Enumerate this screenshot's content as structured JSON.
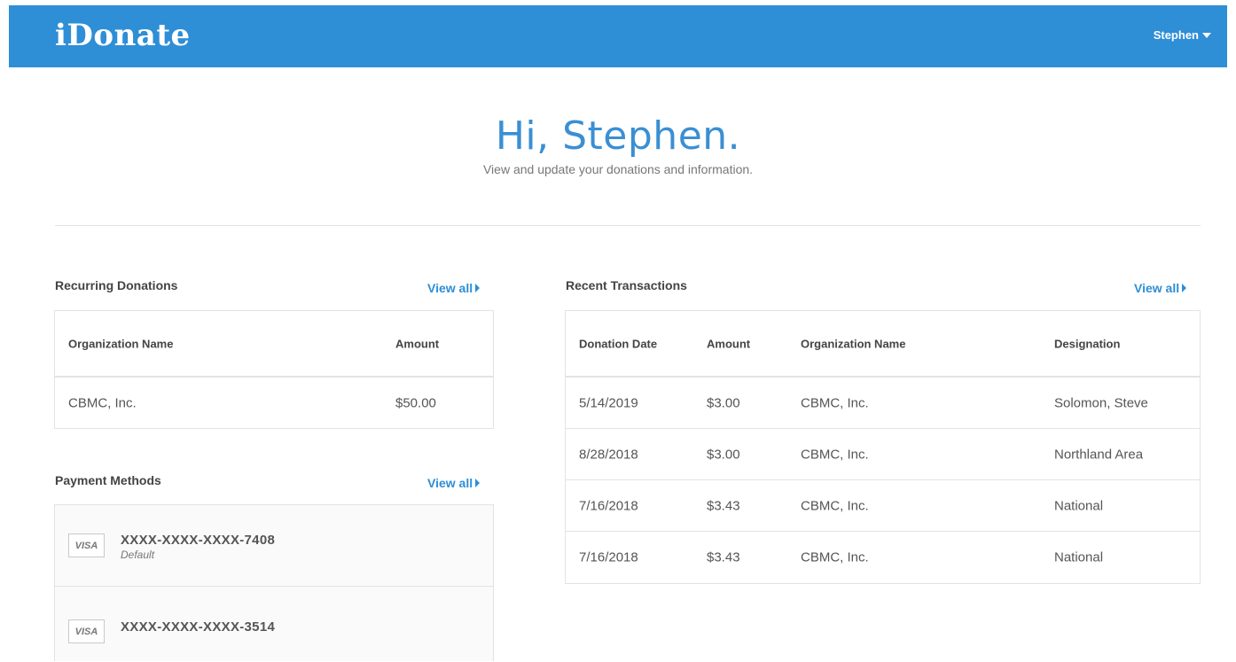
{
  "header": {
    "logo": "iDonate",
    "user_name": "Stephen",
    "brand_color": "#2e8ed6"
  },
  "greeting": {
    "title": "Hi, Stephen.",
    "subtitle": "View and update your donations and information."
  },
  "recurring": {
    "title": "Recurring Donations",
    "view_all": "View all",
    "columns": [
      "Organization Name",
      "Amount"
    ],
    "rows": [
      [
        "CBMC, Inc.",
        "$50.00"
      ]
    ]
  },
  "payment": {
    "title": "Payment Methods",
    "view_all": "View all",
    "cards": [
      {
        "brand": "VISA",
        "number": "XXXX-XXXX-XXXX-7408",
        "note": "Default"
      },
      {
        "brand": "VISA",
        "number": "XXXX-XXXX-XXXX-3514",
        "note": ""
      }
    ]
  },
  "transactions": {
    "title": "Recent Transactions",
    "view_all": "View all",
    "columns": [
      "Donation Date",
      "Amount",
      "Organization Name",
      "Designation"
    ],
    "rows": [
      [
        "5/14/2019",
        "$3.00",
        "CBMC, Inc.",
        "Solomon, Steve"
      ],
      [
        "8/28/2018",
        "$3.00",
        "CBMC, Inc.",
        "Northland Area"
      ],
      [
        "7/16/2018",
        "$3.43",
        "CBMC, Inc.",
        "National"
      ],
      [
        "7/16/2018",
        "$3.43",
        "CBMC, Inc.",
        "National"
      ]
    ]
  }
}
